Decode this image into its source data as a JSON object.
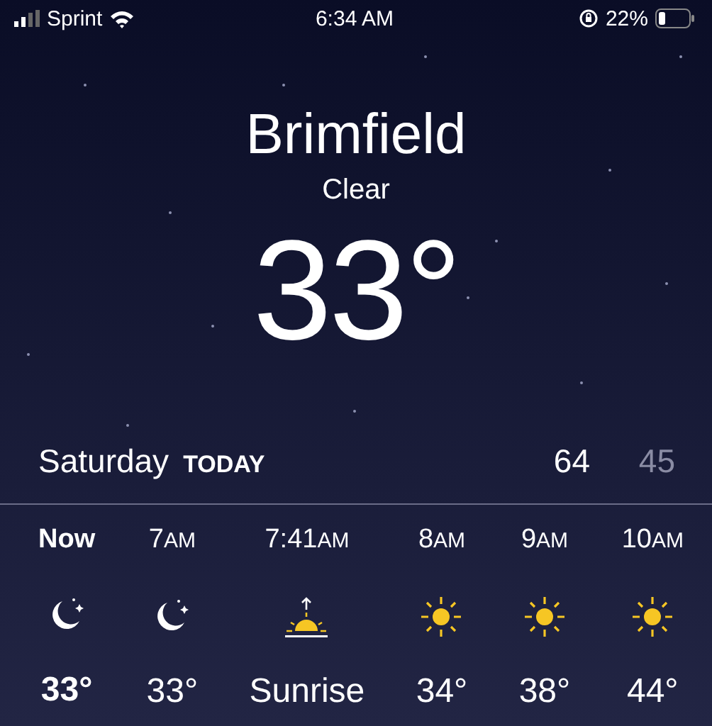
{
  "status_bar": {
    "carrier": "Sprint",
    "time": "6:34 AM",
    "battery": "22%"
  },
  "location": {
    "city": "Brimfield",
    "condition": "Clear",
    "temperature": "33°"
  },
  "today": {
    "day": "Saturday",
    "label": "TODAY",
    "high": "64",
    "low": "45"
  },
  "hourly": [
    {
      "time": "Now",
      "now": true,
      "kind": "moon",
      "temp": "33°"
    },
    {
      "time": "7",
      "suffix": "AM",
      "now": false,
      "kind": "moon",
      "temp": "33°"
    },
    {
      "time": "7:41",
      "suffix": "AM",
      "now": false,
      "kind": "sunrise",
      "temp": "Sunrise"
    },
    {
      "time": "8",
      "suffix": "AM",
      "now": false,
      "kind": "sun",
      "temp": "34°"
    },
    {
      "time": "9",
      "suffix": "AM",
      "now": false,
      "kind": "sun",
      "temp": "38°"
    },
    {
      "time": "10",
      "suffix": "AM",
      "now": false,
      "kind": "sun",
      "temp": "44°"
    }
  ]
}
